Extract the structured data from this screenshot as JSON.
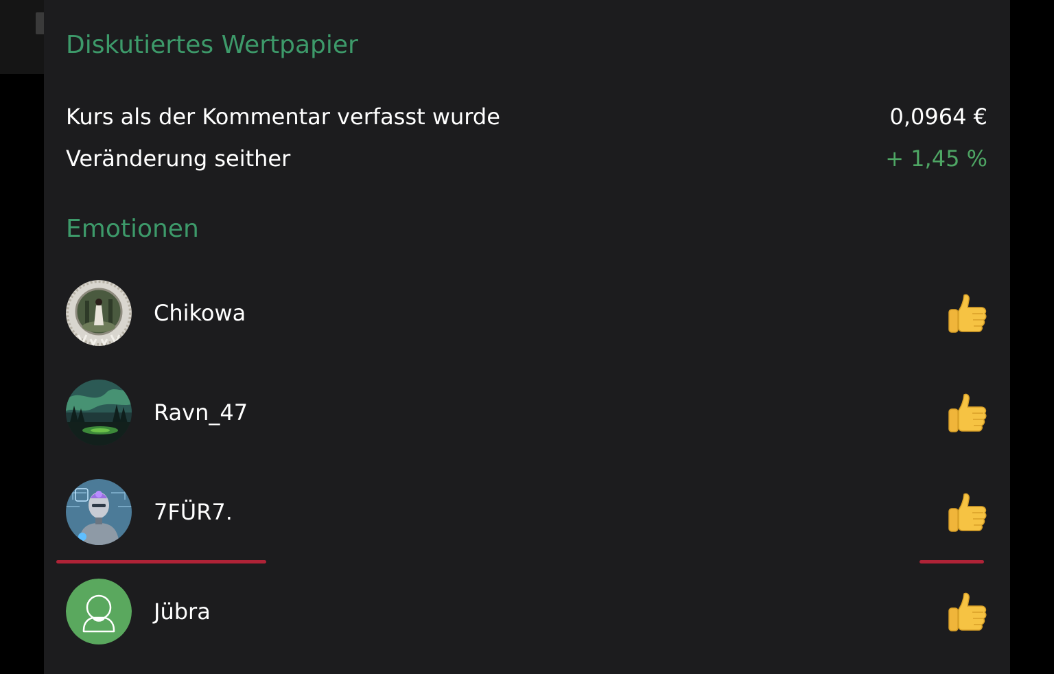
{
  "security": {
    "title": "Diskutiertes Wertpapier",
    "price_label": "Kurs als der Kommentar verfasst wurde",
    "price_value": "0,0964 €",
    "change_label": "Veränderung seither",
    "change_value": "+ 1,45 %"
  },
  "emotions": {
    "title": "Emotionen",
    "items": [
      {
        "username": "Chikowa",
        "avatar": "photo-avatar-forest-woman",
        "reaction": "thumbs-up-icon"
      },
      {
        "username": "Ravn_47",
        "avatar": "photo-avatar-aurora-landscape",
        "reaction": "thumbs-up-icon"
      },
      {
        "username": "7FÜR7.",
        "avatar": "photo-avatar-robot",
        "reaction": "thumbs-up-icon"
      },
      {
        "username": "Jübra",
        "avatar": "default-user-avatar-icon",
        "reaction": "thumbs-up-icon"
      }
    ]
  },
  "colors": {
    "panel_background": "#1c1c1e",
    "section_title": "#3d9a6a",
    "positive_change": "#4ea664",
    "default_avatar": "#5aa85e",
    "highlight_mark": "#c0253a",
    "thumbs_up": "#f6c343"
  }
}
